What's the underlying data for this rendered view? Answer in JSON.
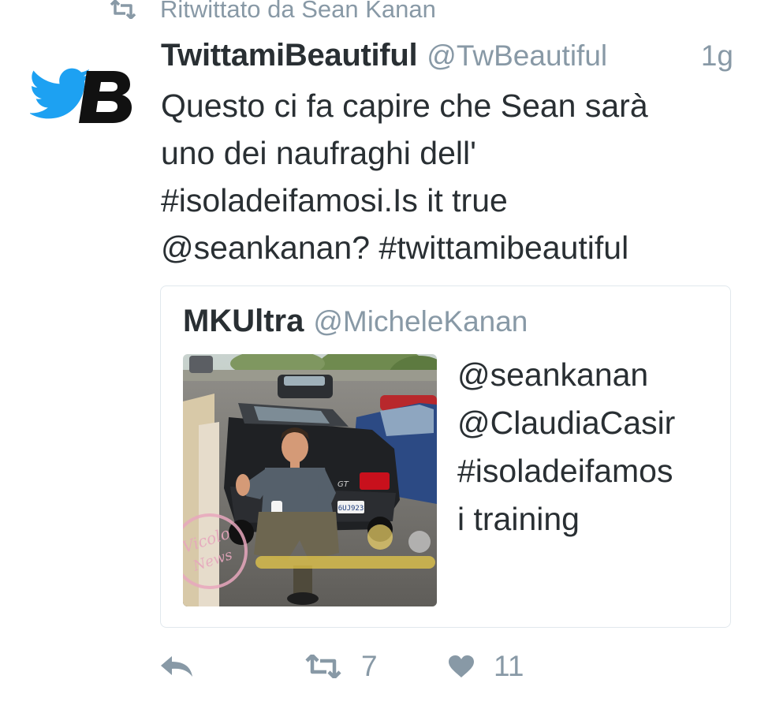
{
  "retweet_context": {
    "text": "Ritwittato da Sean Kanan",
    "icon": "retweet-icon"
  },
  "tweet": {
    "avatar_icon": "twitter-bird-b-logo",
    "author_name": "TwittamiBeautiful",
    "author_handle": "@TwBeautiful",
    "timestamp": "1g",
    "text": "Questo ci fa capire che Sean sarà\nuno dei naufraghi dell'\n#isoladeifamosi.Is it true\n@seankanan? #twittamibeautiful"
  },
  "quoted_tweet": {
    "author_name": "MKUltra",
    "author_handle": "@MicheleKanan",
    "text": "@seankanan\n@ClaudiaCasir\n#isoladeifamos\ni training",
    "media_icon": "photo-man-with-convertible-car"
  },
  "actions": {
    "reply_icon": "reply-icon",
    "retweet_icon": "retweet-icon",
    "retweet_count": "7",
    "like_icon": "heart-icon",
    "like_count": "11"
  },
  "colors": {
    "text": "#292f33",
    "secondary": "#8899a6",
    "border": "#e1e8ed",
    "twitter_blue": "#1da1f2"
  }
}
